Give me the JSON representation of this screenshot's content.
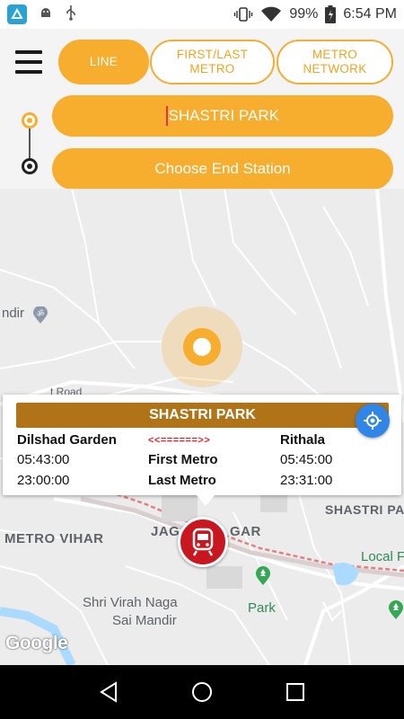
{
  "status_bar": {
    "battery": "99%",
    "time": "6:54 PM"
  },
  "tabs": {
    "line": "LINE",
    "first_last_line1": "FIRST/LAST",
    "first_last_line2": "METRO",
    "network_line1": "METRO",
    "network_line2": "NETWORK"
  },
  "start_station": "SHASTRI PARK",
  "end_station_placeholder": "Choose End Station",
  "map": {
    "labels": {
      "andir": "ndir",
      "road": "t Road",
      "metro_vihar": "METRO VIHAR",
      "jag_left": "JAG",
      "jag_right": "GAR",
      "shastri_park": "SHASTRI PA",
      "local": "Local F",
      "park": "Park",
      "shri_line1": "Shri Virah Naga",
      "shri_line2": "Sai Mandir"
    },
    "attribution": "Google"
  },
  "info_card": {
    "title": "SHASTRI PARK",
    "from_station": "Dilshad Garden",
    "direction_arrow": "<<======>>",
    "to_station": "Rithala",
    "first_left": "05:43:00",
    "first_label": "First Metro",
    "first_right": "05:45:00",
    "last_left": "23:00:00",
    "last_label": "Last Metro",
    "last_right": "23:31:00"
  },
  "colors": {
    "accent": "#f7ad2e",
    "card_title": "#b07318",
    "metro_red": "#c8171e",
    "locate_blue": "#2f86e6"
  },
  "icons": [
    "app-icon",
    "android-icon",
    "usb-icon",
    "vibrate-icon",
    "wifi-icon",
    "battery-icon",
    "menu-icon",
    "my-location-icon",
    "metro-train-icon",
    "back-icon",
    "home-icon",
    "recents-icon"
  ]
}
